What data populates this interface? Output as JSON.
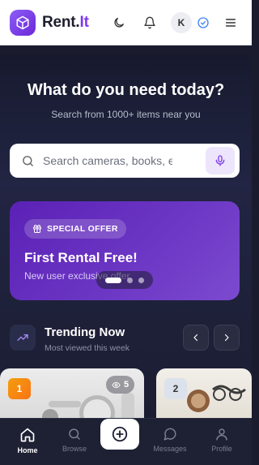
{
  "header": {
    "brand_main": "Rent.",
    "brand_accent": "It",
    "avatar_initial": "K",
    "icons": [
      "cube-icon",
      "moon-icon",
      "bell-icon",
      "verified-icon",
      "menu-icon"
    ]
  },
  "hero": {
    "title": "What do you need today?",
    "subtitle": "Search from 1000+ items near you"
  },
  "search": {
    "placeholder": "Search cameras, books, el",
    "icons": [
      "search-icon",
      "mic-icon"
    ]
  },
  "promo": {
    "badge": "SPECIAL OFFER",
    "title": "First Rental Free!",
    "subtitle": "New user exclusive offer",
    "carousel_dots": 3,
    "active_dot": 1
  },
  "trending": {
    "title": "Trending Now",
    "subtitle": "Most viewed this week",
    "cards": [
      {
        "rank": "1",
        "views": "5"
      },
      {
        "rank": "2"
      }
    ]
  },
  "nav": {
    "items": [
      {
        "label": "Home",
        "icon": "home-icon",
        "active": true
      },
      {
        "label": "Browse",
        "icon": "search-icon"
      },
      {
        "label": "Messages",
        "icon": "chat-icon"
      },
      {
        "label": "Profile",
        "icon": "user-icon"
      }
    ],
    "fab_icon": "plus-circle-icon"
  },
  "colors": {
    "accent": "#7c3aed",
    "hero_bg": "#1a1c2e",
    "promo_bg": "#5b21b6",
    "rank1": "#f59e0b"
  }
}
